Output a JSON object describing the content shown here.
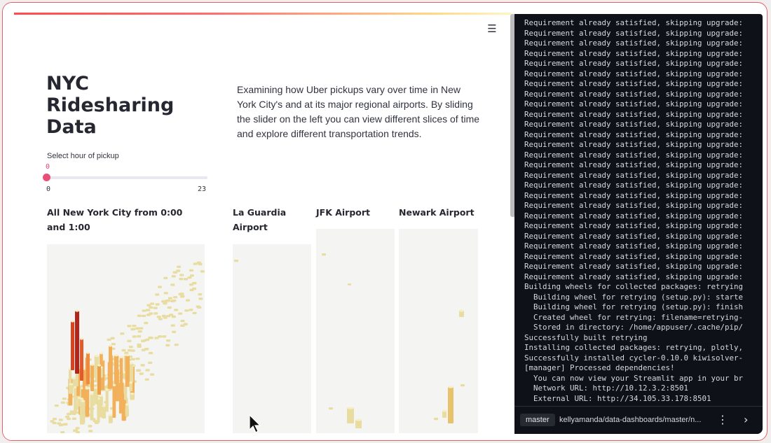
{
  "app": {
    "title": "NYC Ridesharing Data",
    "description": "Examining how Uber pickups vary over time in New York City's and at its major regional airports. By sliding the slider on the left you can view different slices of time and explore different transportation trends.",
    "menu_icon": "hamburger-menu-icon",
    "slider": {
      "label": "Select hour of pickup",
      "value": "0",
      "min_label": "0",
      "max_label": "23",
      "value_fraction": 0.0,
      "accent": "#ea4d77"
    },
    "sections": {
      "nyc": "All New York City from 0:00 and 1:00",
      "laguardia": "La Guardia Airport",
      "jfk": "JFK Airport",
      "newark": "Newark Airport"
    }
  },
  "terminal": {
    "lines": [
      "Requirement already satisfied, skipping upgrade:",
      "Requirement already satisfied, skipping upgrade:",
      "Requirement already satisfied, skipping upgrade:",
      "Requirement already satisfied, skipping upgrade:",
      "Requirement already satisfied, skipping upgrade:",
      "Requirement already satisfied, skipping upgrade:",
      "Requirement already satisfied, skipping upgrade:",
      "Requirement already satisfied, skipping upgrade:",
      "Requirement already satisfied, skipping upgrade:",
      "Requirement already satisfied, skipping upgrade:",
      "Requirement already satisfied, skipping upgrade:",
      "Requirement already satisfied, skipping upgrade:",
      "Requirement already satisfied, skipping upgrade:",
      "Requirement already satisfied, skipping upgrade:",
      "Requirement already satisfied, skipping upgrade:",
      "Requirement already satisfied, skipping upgrade:",
      "Requirement already satisfied, skipping upgrade:",
      "Requirement already satisfied, skipping upgrade:",
      "Requirement already satisfied, skipping upgrade:",
      "Requirement already satisfied, skipping upgrade:",
      "Requirement already satisfied, skipping upgrade:",
      "Requirement already satisfied, skipping upgrade:",
      "Requirement already satisfied, skipping upgrade:",
      "Requirement already satisfied, skipping upgrade:",
      "Requirement already satisfied, skipping upgrade:",
      "Requirement already satisfied, skipping upgrade:",
      "Building wheels for collected packages: retrying",
      "  Building wheel for retrying (setup.py): starte",
      "  Building wheel for retrying (setup.py): finish",
      "  Created wheel for retrying: filename=retrying-",
      "  Stored in directory: /home/appuser/.cache/pip/",
      "Successfully built retrying",
      "Installing collected packages: retrying, plotly,",
      "Successfully installed cycler-0.10.0 kiwisolver-",
      "[manager] Processed dependencies!",
      "  You can now view your Streamlit app in your br",
      "  Network URL: http://10.12.3.2:8501",
      "  External URL: http://34.105.33.178:8501"
    ],
    "branch": "master",
    "repo_path": "kellyamanda/data-dashboards/master/n...",
    "more_icon": "kebab-menu-icon",
    "next_icon": "chevron-right-icon"
  },
  "colors": {
    "accent": "#ea4d77",
    "terminal_bg": "#0e1117",
    "bar_low": "#e8dca0",
    "bar_mid": "#f2b05a",
    "bar_high": "#b3241a"
  }
}
